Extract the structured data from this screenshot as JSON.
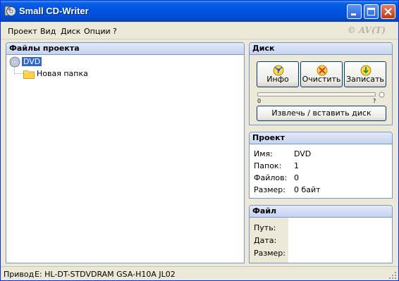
{
  "window": {
    "title": "Small CD-Writer"
  },
  "menu": {
    "items": [
      "Проект",
      "Вид",
      "Диск",
      "Опции",
      "?"
    ],
    "brand": "© AV(T)"
  },
  "files_panel": {
    "title": "Файлы проекта",
    "root_label": "DVD",
    "folder_label": "Новая папка"
  },
  "disk_panel": {
    "title": "Диск",
    "buttons": {
      "info": "Инфо",
      "clear": "Очистить",
      "write": "Записать"
    },
    "slider": {
      "min_label": "0",
      "max_label": "?"
    },
    "eject_label": "Извлечь / вставить диск"
  },
  "project_panel": {
    "title": "Проект",
    "rows": [
      {
        "label": "Имя:",
        "value": "DVD"
      },
      {
        "label": "Папок:",
        "value": "1"
      },
      {
        "label": "Файлов:",
        "value": "0"
      },
      {
        "label": "Размер:",
        "value": "0 байт"
      }
    ]
  },
  "file_panel": {
    "title": "Файл",
    "rows": [
      {
        "label": "Путь:",
        "value": ""
      },
      {
        "label": "Дата:",
        "value": ""
      },
      {
        "label": "Размер:",
        "value": ""
      }
    ]
  },
  "status": {
    "drive_label": "Привод",
    "drive_value": "E: HL-DT-STDVDRAM GSA-H10A JL02"
  },
  "colors": {
    "titlebar": "#0054e3",
    "selection": "#316ac5",
    "panel_border": "#7a98c4"
  }
}
